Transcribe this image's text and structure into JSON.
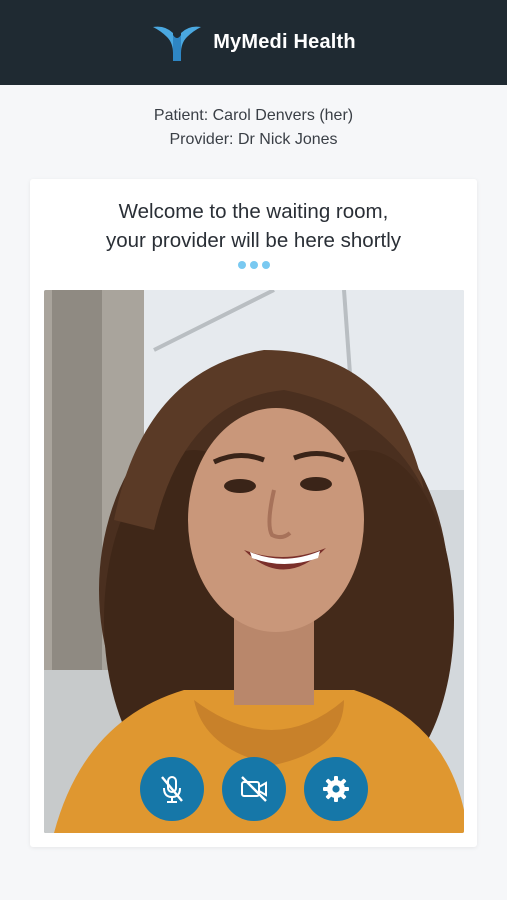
{
  "header": {
    "brand_name": "MyMedi Health",
    "logo_icon": "mymedi-logo-icon",
    "background_color": "#1f2a32",
    "accent_color": "#4aa8e0"
  },
  "session": {
    "patient_line": "Patient: Carol Denvers (her)",
    "provider_line": "Provider: Dr Nick Jones"
  },
  "waiting_room": {
    "message_line1": "Welcome to the waiting room,",
    "message_line2": "your provider will be here shortly",
    "loading_indicator": "typing-dots-icon",
    "dot_color": "#79c9f1"
  },
  "video": {
    "feed": "self-view-camera-feed",
    "controls": [
      {
        "name": "mute-microphone-button",
        "icon": "microphone-off-icon"
      },
      {
        "name": "toggle-camera-button",
        "icon": "camera-off-icon"
      },
      {
        "name": "settings-button",
        "icon": "gear-icon"
      }
    ],
    "control_color": "#1677a8"
  }
}
